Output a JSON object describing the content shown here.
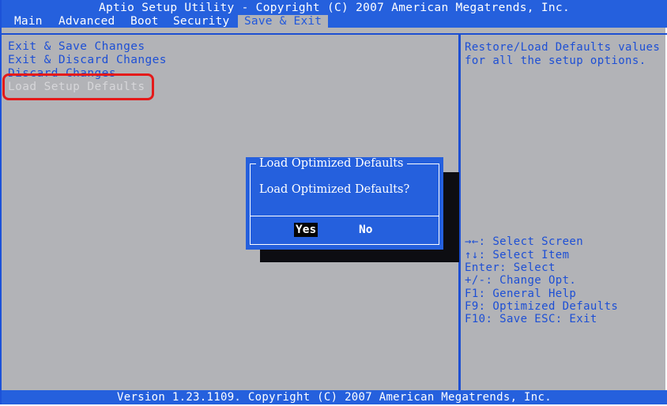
{
  "header": {
    "title": "Aptio Setup Utility - Copyright (C) 2007 American Megatrends, Inc.",
    "tabs": [
      "Main",
      "Advanced",
      "Boot",
      "Security",
      "Save & Exit"
    ],
    "active_tab": "Save & Exit"
  },
  "menu": {
    "items": [
      "Exit & Save Changes",
      "Exit & Discard Changes",
      "Discard Changes",
      "Load Setup Defaults"
    ],
    "selected": "Load Setup Defaults"
  },
  "help": {
    "description": [
      "Restore/Load Defaults values",
      "for all the setup options."
    ],
    "keys": [
      "→←: Select Screen",
      "↑↓: Select Item",
      "Enter: Select",
      "+/-: Change Opt.",
      "F1: General Help",
      "F9: Optimized Defaults",
      "F10: Save  ESC: Exit"
    ]
  },
  "dialog": {
    "title": "Load Optimized Defaults",
    "message": "Load Optimized Defaults?",
    "yes_label": "Yes",
    "no_label": "No",
    "selected": "Yes"
  },
  "footer": {
    "text": "Version 1.23.1109. Copyright (C) 2007 American Megatrends, Inc."
  },
  "colors": {
    "bios_blue": "#2560dd",
    "background_gray": "#b2b3b7",
    "highlight_red": "#e41a1a"
  }
}
